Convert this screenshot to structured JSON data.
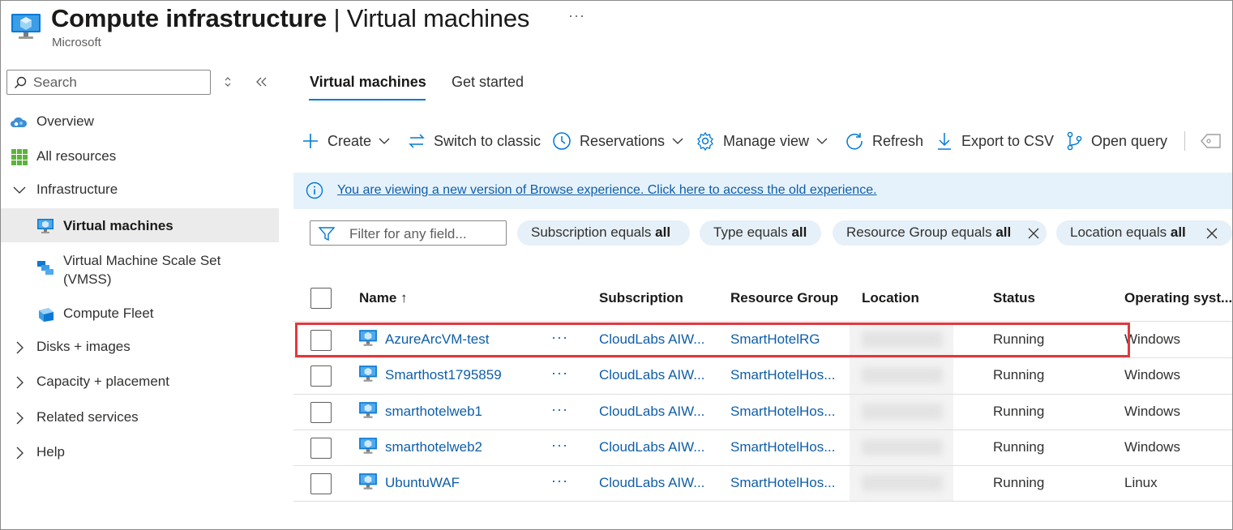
{
  "header": {
    "title_bold": "Compute infrastructure",
    "title_rest": "| Virtual machines",
    "subtitle": "Microsoft",
    "more": "···"
  },
  "sidebar": {
    "search_placeholder": "Search",
    "items": [
      {
        "label": "Overview",
        "icon": "cloud-icon"
      },
      {
        "label": "All resources",
        "icon": "grid-icon"
      },
      {
        "label": "Infrastructure",
        "icon": "chevron-down-icon"
      },
      {
        "label": "Virtual machines",
        "icon": "vm-icon"
      },
      {
        "label": "Virtual Machine Scale Set",
        "label2": "(VMSS)",
        "icon": "vmss-icon"
      },
      {
        "label": "Compute Fleet",
        "icon": "fleet-icon"
      },
      {
        "label": "Disks + images",
        "icon": "chevron-right-icon"
      },
      {
        "label": "Capacity + placement",
        "icon": "chevron-right-icon"
      },
      {
        "label": "Related services",
        "icon": "chevron-right-icon"
      },
      {
        "label": "Help",
        "icon": "chevron-right-icon"
      }
    ]
  },
  "tabs": [
    {
      "label": "Virtual machines",
      "active": true
    },
    {
      "label": "Get started",
      "active": false
    }
  ],
  "toolbar": {
    "create": "Create",
    "switch": "Switch to classic",
    "reservations": "Reservations",
    "manage_view": "Manage view",
    "refresh": "Refresh",
    "export": "Export to CSV",
    "open_query": "Open query"
  },
  "banner": {
    "text": "You are viewing a new version of Browse experience. Click here to access the old experience."
  },
  "filters": {
    "placeholder": "Filter for any field...",
    "pills": [
      {
        "field": "Subscription",
        "op": "equals",
        "value": "all",
        "removable": false
      },
      {
        "field": "Type",
        "op": "equals",
        "value": "all",
        "removable": false
      },
      {
        "field": "Resource Group",
        "op": "equals",
        "value": "all",
        "removable": true
      },
      {
        "field": "Location",
        "op": "equals",
        "value": "all",
        "removable": true
      }
    ]
  },
  "table": {
    "columns": [
      "Name ↑",
      "Subscription",
      "Resource Group",
      "Location",
      "Status",
      "Operating syst..."
    ],
    "rows": [
      {
        "name": "AzureArcVM-test",
        "subscription": "CloudLabs AIW...",
        "resource_group": "SmartHotelRG",
        "status": "Running",
        "os": "Windows"
      },
      {
        "name": "Smarthost1795859",
        "subscription": "CloudLabs AIW...",
        "resource_group": "SmartHotelHos...",
        "status": "Running",
        "os": "Windows"
      },
      {
        "name": "smarthotelweb1",
        "subscription": "CloudLabs AIW...",
        "resource_group": "SmartHotelHos...",
        "status": "Running",
        "os": "Windows"
      },
      {
        "name": "smarthotelweb2",
        "subscription": "CloudLabs AIW...",
        "resource_group": "SmartHotelHos...",
        "status": "Running",
        "os": "Windows"
      },
      {
        "name": "UbuntuWAF",
        "subscription": "CloudLabs AIW...",
        "resource_group": "SmartHotelHos...",
        "status": "Running",
        "os": "Linux"
      }
    ],
    "row_more": "···"
  },
  "colors": {
    "accent": "#0078d4",
    "link": "#0f5ea8",
    "highlight": "#e0393e"
  }
}
